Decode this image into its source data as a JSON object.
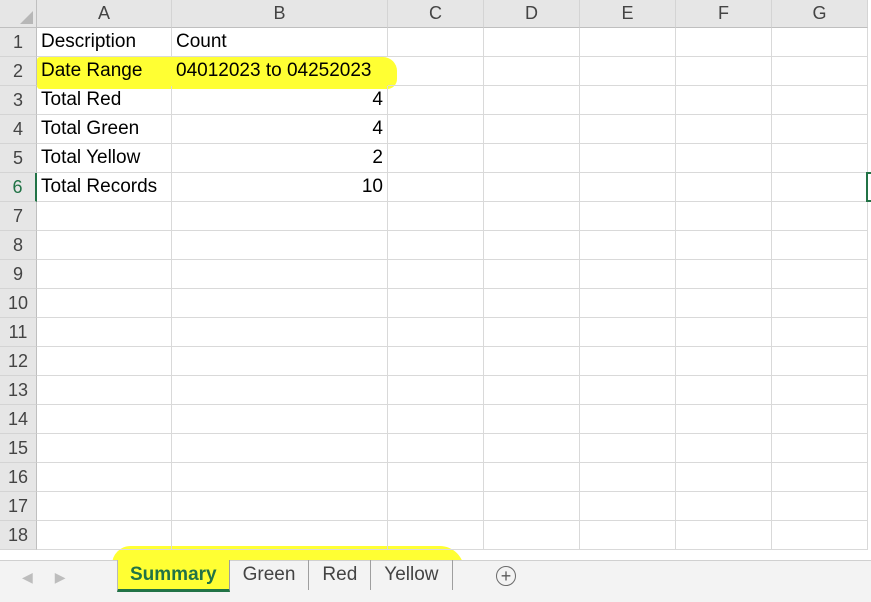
{
  "columns": [
    "A",
    "B",
    "C",
    "D",
    "E",
    "F",
    "G"
  ],
  "rows": [
    "1",
    "2",
    "3",
    "4",
    "5",
    "6",
    "7",
    "8",
    "9",
    "10",
    "11",
    "12",
    "13",
    "14",
    "15",
    "16",
    "17",
    "18"
  ],
  "cells": {
    "r1": {
      "a": "Description",
      "b": "Count"
    },
    "r2": {
      "a": "Date Range",
      "b": "04012023 to 04252023"
    },
    "r3": {
      "a": "Total Red",
      "b": "4"
    },
    "r4": {
      "a": "Total Green",
      "b": "4"
    },
    "r5": {
      "a": "Total Yellow",
      "b": "2"
    },
    "r6": {
      "a": "Total Records",
      "b": "10"
    }
  },
  "active_row": "6",
  "highlight_color": "#ffff33",
  "accent_color": "#217346",
  "sheet_tabs": [
    "Summary",
    "Green",
    "Red",
    "Yellow"
  ],
  "active_tab": "Summary",
  "icons": {
    "nav_prev": "chevron-left-icon",
    "nav_next": "chevron-right-icon",
    "add_sheet": "plus-circle-icon"
  },
  "add_sheet_symbol": "+"
}
